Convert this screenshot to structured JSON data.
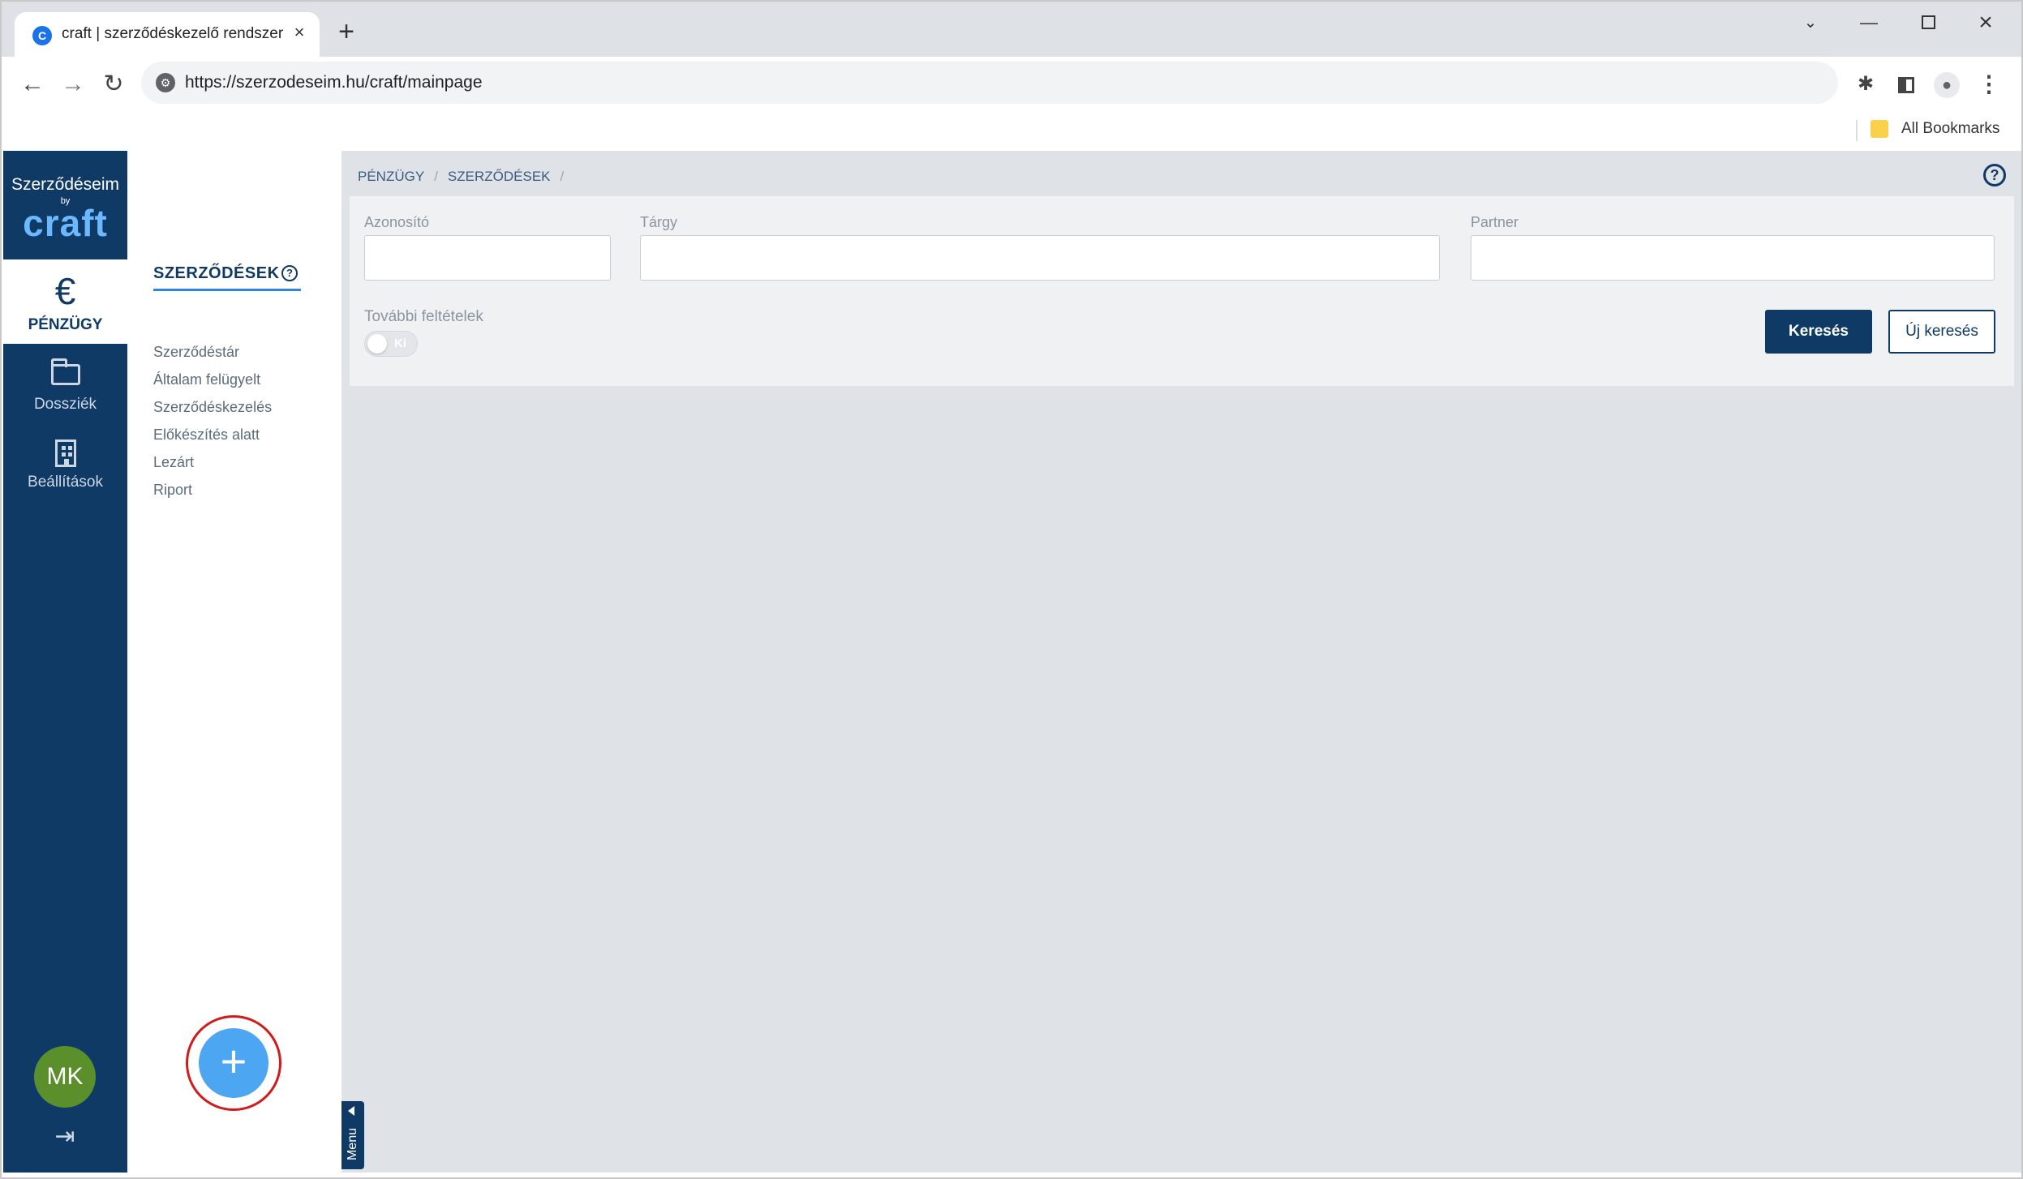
{
  "browser": {
    "tab_title": "craft | szerződéskezelő rendszer",
    "tab_favicon": "C",
    "url": "https://szerzodeseim.hu/craft/mainpage",
    "bookmarks_label": "All Bookmarks"
  },
  "logo": {
    "top": "Szerződéseim",
    "by": "by",
    "brand": "craft",
    "brand_color": "#6cb8ff"
  },
  "rail": {
    "items": [
      {
        "label": "PÉNZÜGY",
        "icon": "euro-icon",
        "glyph": "€",
        "active": true
      },
      {
        "label": "Dossziék",
        "icon": "folder-icon",
        "active": false
      },
      {
        "label": "Beállítások",
        "icon": "building-icon",
        "active": false
      }
    ],
    "avatar_initials": "MK",
    "avatar_color": "#5a8f2c",
    "logout_icon": "logout-icon"
  },
  "subnav": {
    "title": "SZERZŐDÉSEK",
    "help_glyph": "?",
    "items": [
      "Szerződéstár",
      "Általam felügyelt",
      "Szerződéskezelés",
      "Előkészítés alatt",
      "Lezárt",
      "Riport"
    ],
    "fab_glyph": "+",
    "menu_label": "Menu"
  },
  "main": {
    "breadcrumb": [
      "PÉNZÜGY",
      "SZERZŐDÉSEK"
    ],
    "breadcrumb_sep": "/",
    "help_glyph": "?",
    "filters": {
      "azonosito_label": "Azonosító",
      "azonosito_value": "",
      "targy_label": "Tárgy",
      "targy_value": "",
      "partner_label": "Partner",
      "partner_value": "",
      "more_label": "További feltételek",
      "toggle_text": "Ki",
      "search_button": "Keresés",
      "new_search_button": "Új keresés"
    }
  },
  "colors": {
    "primary": "#0f3a66",
    "accent": "#2e86de",
    "fab": "#4da6f2",
    "highlight_ring": "#d11a1a"
  }
}
